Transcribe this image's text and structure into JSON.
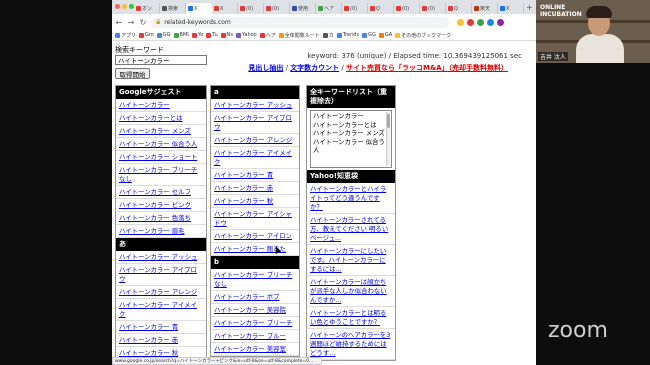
{
  "browser": {
    "tabs": [
      {
        "label": "オン",
        "color": "#e53935"
      },
      {
        "label": "検索",
        "color": "#555555"
      },
      {
        "label": "X",
        "color": "#1a73e8",
        "active": true
      },
      {
        "label": "X",
        "color": "#e53935"
      },
      {
        "label": "(0)",
        "color": "#e53935"
      },
      {
        "label": "(0)",
        "color": "#e53935"
      },
      {
        "label": "使用",
        "color": "#3949ab"
      },
      {
        "label": "ヘア",
        "color": "#43a047"
      },
      {
        "label": "(0)",
        "color": "#e53935"
      },
      {
        "label": "Q",
        "color": "#e53935"
      },
      {
        "label": "(0)",
        "color": "#e53935"
      },
      {
        "label": "(0)",
        "color": "#e53935"
      },
      {
        "label": "Q",
        "color": "#e53935"
      },
      {
        "label": "楽天",
        "color": "#bf360c"
      },
      {
        "label": "X",
        "color": "#1a73e8"
      }
    ],
    "url": "related-keywords.com",
    "bookmarks": [
      {
        "label": "アプリ",
        "color": "#4285f4"
      },
      {
        "label": "Gm",
        "color": "#e53935"
      },
      {
        "label": "GG",
        "color": "#4285f4"
      },
      {
        "label": "BMI",
        "color": "#43a047"
      },
      {
        "label": "Yo",
        "color": "#e53935"
      },
      {
        "label": "Tu",
        "color": "#e53935"
      },
      {
        "label": "Ns",
        "color": "#e53935"
      },
      {
        "label": "Yahoo",
        "color": "#7e57c2"
      },
      {
        "label": "ヘア",
        "color": "#e53935"
      },
      {
        "label": "全体閲覧ルート",
        "color": "#ff9800"
      },
      {
        "label": "カ",
        "color": "#555555"
      },
      {
        "label": "Trends",
        "color": "#4285f4"
      },
      {
        "label": "GG",
        "color": "#4285f4"
      },
      {
        "label": "GA",
        "color": "#f57c00"
      },
      {
        "label": "その他のブックマーク",
        "color": "#fbc02d"
      }
    ]
  },
  "search": {
    "label": "検索キーワード",
    "value": "ハイトーンカラー",
    "button": "取得開始"
  },
  "stats": "keyword: 376 (unique) / Elapsed time: 10.369439125061 sec",
  "toplinks": {
    "link1": "見出し抽出",
    "sep1": " / ",
    "link2": "文字数カウント",
    "sep2": " / ",
    "link3": "サイト売買なら「ラッコM&A」（売却手数料無料）"
  },
  "google_col": {
    "header": "Googleサジェスト",
    "items": [
      "ハイトーンカラー",
      "ハイトーンカラーとは",
      "ハイトーンカラー メンズ",
      "ハイトーンカラー 似合う人",
      "ハイトーンカラー ショート",
      "ハイトーンカラー ブリーチなし",
      "ハイトーンカラー セルフ",
      "ハイトーンカラー ピンク",
      "ハイトーンカラー 色落ち",
      "ハイトーンカラー 眉毛"
    ],
    "sub_header": "あ",
    "sub_items": [
      "ハイトーンカラー アッシュ",
      "ハイトーンカラー アイブロウ",
      "ハイトーンカラー アレンジ",
      "ハイトーンカラー アイメイク",
      "ハイトーンカラー 青",
      "ハイトーンカラー 赤",
      "ハイトーンカラー 秋"
    ]
  },
  "a_col": {
    "header": "a",
    "items": [
      "ハイトーンカラー アッシュ",
      "ハイトーンカラー アイブロウ",
      "ハイトーンカラー アレンジ",
      "ハイトーンカラー アイメイク",
      "ハイトーンカラー 青",
      "ハイトーンカラー 赤",
      "ハイトーンカラー 秋",
      "ハイトーンカラー アイシャドウ",
      "ハイトーンカラー アイロン",
      "ハイトーンカラー 飽きた"
    ],
    "sub_header": "b",
    "sub_items": [
      "ハイトーンカラー ブリーチなし",
      "ハイトーンカラー ボブ",
      "ハイトーンカラー 美容院",
      "ハイトーンカラー ブリーチ",
      "ハイトーンカラー ブルー",
      "ハイトーンカラー 美容室"
    ]
  },
  "all_col": {
    "header": "全キーワードリスト（重複除去）",
    "list": [
      "ハイトーンカラー",
      "ハイトーンカラーとは",
      "ハイトーンカラー メンズ",
      "ハイトーンカラー 似合う人"
    ],
    "yahoo_header": "Yahoo!知恵袋",
    "yahoo_items": [
      "ハイトーンカラーとハイライトってどう違うんですか？",
      "ハイトーンカラーされてる方、教えてください 明るいベージュ...",
      "ハイトーンカラーにしたいです。ハイトーンカラーにするには...",
      "ハイトーンカラーは顔立ちが派手な人しか似合わないんですか...",
      "ハイトーンカラーとは明るい色とゆうことですか？",
      "ハイトーンのヘアカラーを3週間ほど維持するためにはどうす..."
    ]
  },
  "statusbar": "www.google.co.jp/search?q=ハイトーンカラー+ピンク&ie=utf-8&oe=utf-8&complete=0...",
  "camera": {
    "logo": "ONLINE\nINCUBATION",
    "name": "吉井 汰人"
  },
  "zoom_logo": "zoom"
}
